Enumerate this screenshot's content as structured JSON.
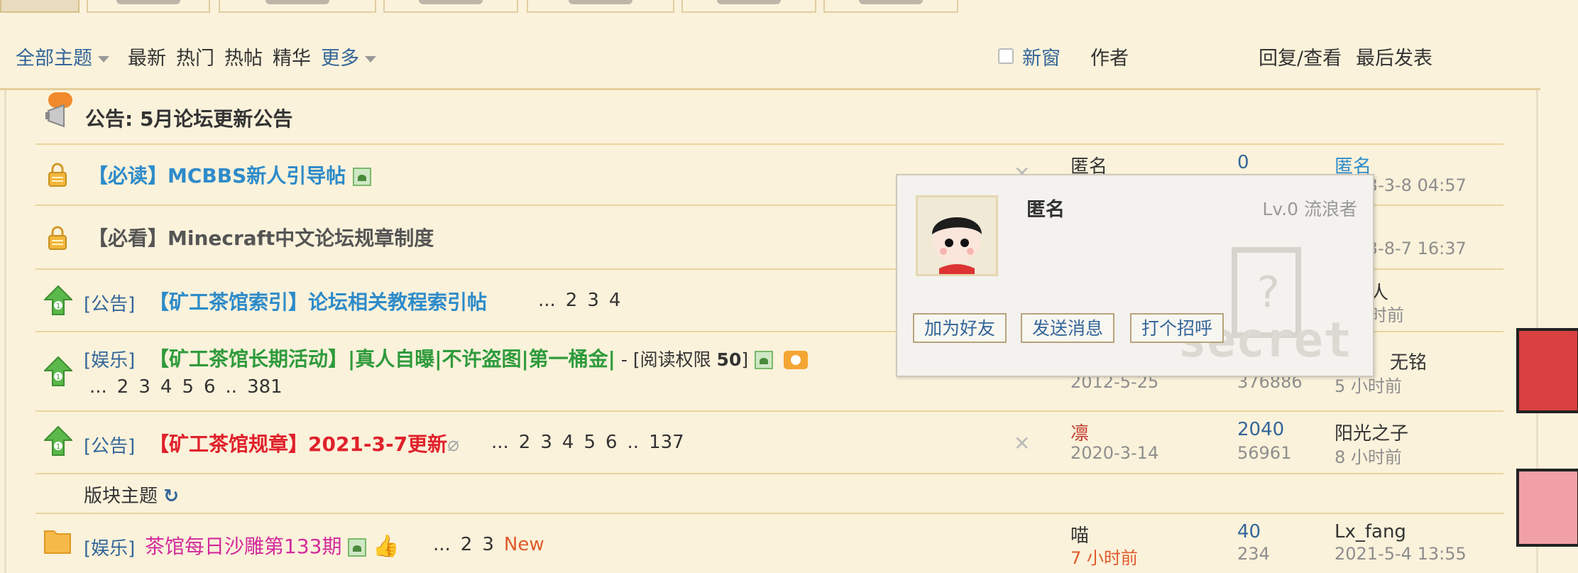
{
  "filter": {
    "all_topics": "全部主题",
    "latest": "最新",
    "hot": "热门",
    "hot_posts": "热帖",
    "digest": "精华",
    "more": "更多",
    "new_window": "新窗",
    "author": "作者",
    "replies_views": "回复/查看",
    "last_post": "最后发表"
  },
  "announcement": {
    "label": "公告:",
    "title": "5月论坛更新公告"
  },
  "threads": [
    {
      "title": "【必读】MCBBS新人引导帖",
      "author": "匿名",
      "date": "",
      "replies": "0",
      "views": "",
      "last_user": "匿名",
      "last_time": "2013-3-8 04:57"
    },
    {
      "title": "【必看】Minecraft中文论坛规章制度",
      "last_time": "2013-8-7 16:37"
    },
    {
      "category": "[公告]",
      "title": "【矿工茶馆索引】论坛相关教程索引帖",
      "pages": [
        "...",
        "2",
        "3",
        "4"
      ],
      "last_user": "人",
      "last_time": "时前"
    },
    {
      "category": "[娱乐]",
      "title": "【矿工茶馆长期活动】|真人自曝|不许盗图|第一桶金|",
      "perm": " - [阅读权限 ",
      "perm_level": "50",
      "perm_end": "]",
      "pages": [
        "...",
        "2",
        "3",
        "4",
        "5",
        "6",
        "..",
        "381"
      ],
      "date": "2012-5-25",
      "views": "376886",
      "last_user": "无铭",
      "last_time": "5 小时前"
    },
    {
      "category": "[公告]",
      "title": "【矿工茶馆规章】2021-3-7更新",
      "pages": [
        "...",
        "2",
        "3",
        "4",
        "5",
        "6",
        "..",
        "137"
      ],
      "author": "凛",
      "date": "2020-3-14",
      "replies": "2040",
      "views": "56961",
      "last_user": "阳光之子",
      "last_time": "8 小时前"
    },
    {
      "category": "[娱乐]",
      "title": "茶馆每日沙雕第133期",
      "pages": [
        "...",
        "2",
        "3"
      ],
      "new_label": "New",
      "author": "喵",
      "date": "7 小时前",
      "replies": "40",
      "views": "234",
      "last_user": "Lx_fang",
      "last_time": "2021-5-4 13:55"
    }
  ],
  "section_header": "版块主题",
  "popup": {
    "name": "匿名",
    "level": "Lv.0 流浪者",
    "add_friend": "加为好友",
    "send_message": "发送消息",
    "greet": "打个招呼",
    "watermark": "secret"
  },
  "colors": {
    "background": "#fbf2db",
    "link": "#336699",
    "title_blue": "#2e8bc9",
    "title_green": "#2f9b3c",
    "title_red": "#e0212b",
    "title_pink": "#d22a9c"
  }
}
